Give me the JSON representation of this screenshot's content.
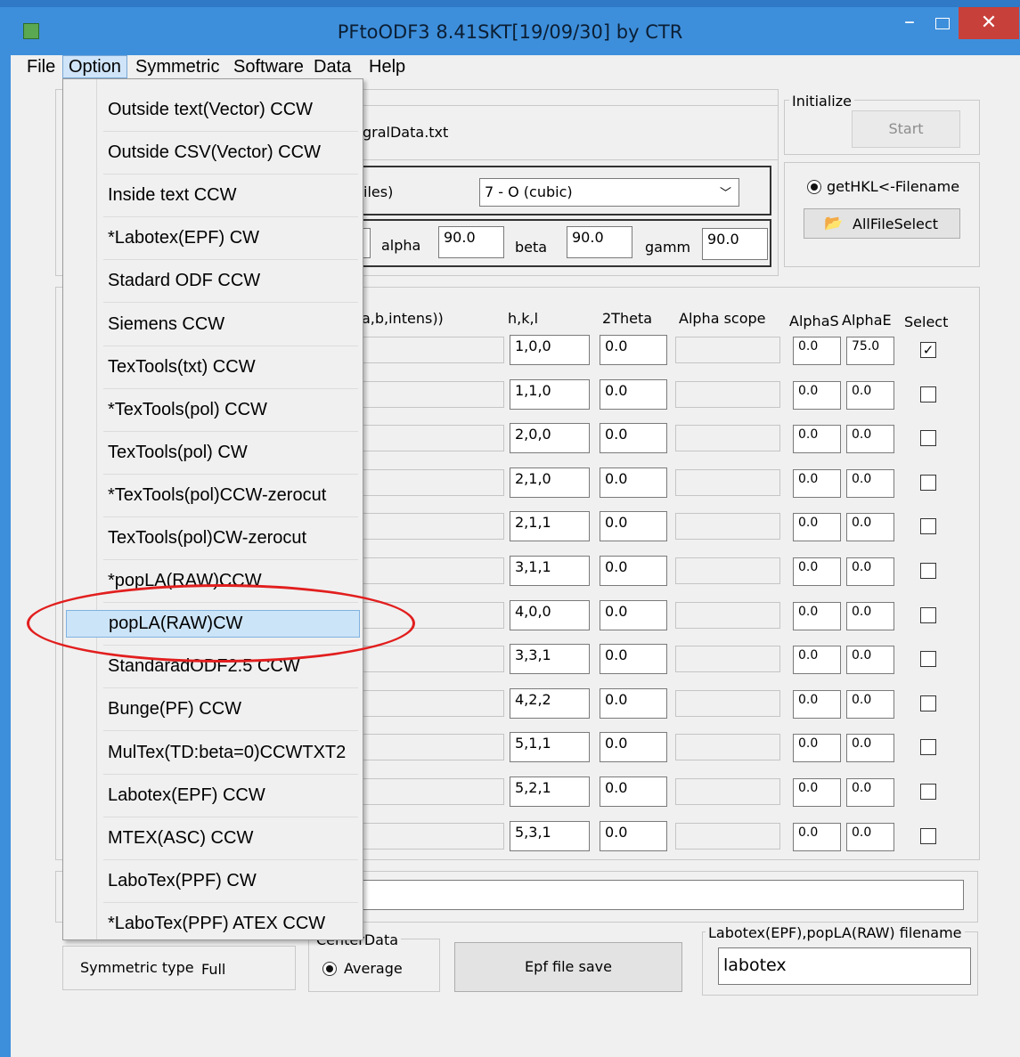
{
  "window": {
    "title": "PFtoODF3 8.41SKT[19/09/30] by CTR",
    "minimize": "–",
    "close": "✕"
  },
  "menubar": [
    "File",
    "Option",
    "Symmetric",
    "Software",
    "Data",
    "Help"
  ],
  "option_menu": {
    "items": [
      "Outside text(Vector) CCW",
      "Outside CSV(Vector) CCW",
      "Inside text CCW",
      "*Labotex(EPF) CW",
      "Stadard ODF CCW",
      "Siemens CCW",
      "TexTools(txt) CCW",
      "*TexTools(pol) CCW",
      "TexTools(pol) CW",
      "*TexTools(pol)CCW-zerocut",
      "TexTools(pol)CW-zerocut",
      "*popLA(RAW)CCW",
      "popLA(RAW)CW",
      "StandaradODF2.5 CCW",
      "Bunge(PF) CCW",
      "MulTex(TD:beta=0)CCWTXT2",
      "Labotex(EPF) CCW",
      "MTEX(ASC) CCW",
      "LaboTex(PPF) CW",
      "*LaboTex(PPF) ATEX CCW"
    ],
    "highlighted": "popLA(RAW)CW"
  },
  "file_panel": {
    "filename_partial": "gralData.txt",
    "files_label_partial": "iles)",
    "symmetry_select": "7 - O (cubic)",
    "alpha_label": "alpha",
    "alpha": "90.0",
    "beta_label": "beta",
    "beta": "90.0",
    "gamma_label": "gamm",
    "gamma": "90.0"
  },
  "initialize": {
    "legend": "Initialize",
    "start": "Start"
  },
  "hkl_panel": {
    "radio_label": "getHKL<-Filename",
    "allfileselect": "AllFileSelect"
  },
  "table": {
    "headers": {
      "file_partial": "a,b,intens))",
      "hkl": "h,k,l",
      "twotheta": "2Theta",
      "alphascope": "Alpha scope",
      "alphas": "AlphaS",
      "alphae": "AlphaE",
      "select": "Select"
    },
    "rows": [
      {
        "hkl": "1,0,0",
        "tt": "0.0",
        "as": "0.0",
        "ae": "75.0",
        "sel": "✓"
      },
      {
        "hkl": "1,1,0",
        "tt": "0.0",
        "as": "0.0",
        "ae": "0.0",
        "sel": ""
      },
      {
        "hkl": "2,0,0",
        "tt": "0.0",
        "as": "0.0",
        "ae": "0.0",
        "sel": ""
      },
      {
        "hkl": "2,1,0",
        "tt": "0.0",
        "as": "0.0",
        "ae": "0.0",
        "sel": ""
      },
      {
        "hkl": "2,1,1",
        "tt": "0.0",
        "as": "0.0",
        "ae": "0.0",
        "sel": ""
      },
      {
        "hkl": "3,1,1",
        "tt": "0.0",
        "as": "0.0",
        "ae": "0.0",
        "sel": ""
      },
      {
        "hkl": "4,0,0",
        "tt": "0.0",
        "as": "0.0",
        "ae": "0.0",
        "sel": ""
      },
      {
        "hkl": "3,3,1",
        "tt": "0.0",
        "as": "0.0",
        "ae": "0.0",
        "sel": ""
      },
      {
        "hkl": "4,2,2",
        "tt": "0.0",
        "as": "0.0",
        "ae": "0.0",
        "sel": ""
      },
      {
        "hkl": "5,1,1",
        "tt": "0.0",
        "as": "0.0",
        "ae": "0.0",
        "sel": ""
      },
      {
        "hkl": "5,2,1",
        "tt": "0.0",
        "as": "0.0",
        "ae": "0.0",
        "sel": ""
      },
      {
        "hkl": "5,3,1",
        "tt": "0.0",
        "as": "0.0",
        "ae": "0.0",
        "sel": ""
      }
    ]
  },
  "bottom": {
    "symmetric_type_label": "Symmetric type",
    "symmetric_type_value": "Full",
    "centerdata_legend": "CenterData",
    "average": "Average",
    "epf_save": "Epf file save",
    "labotex_legend": "Labotex(EPF),popLA(RAW) filename",
    "labotex_value": "labotex"
  }
}
